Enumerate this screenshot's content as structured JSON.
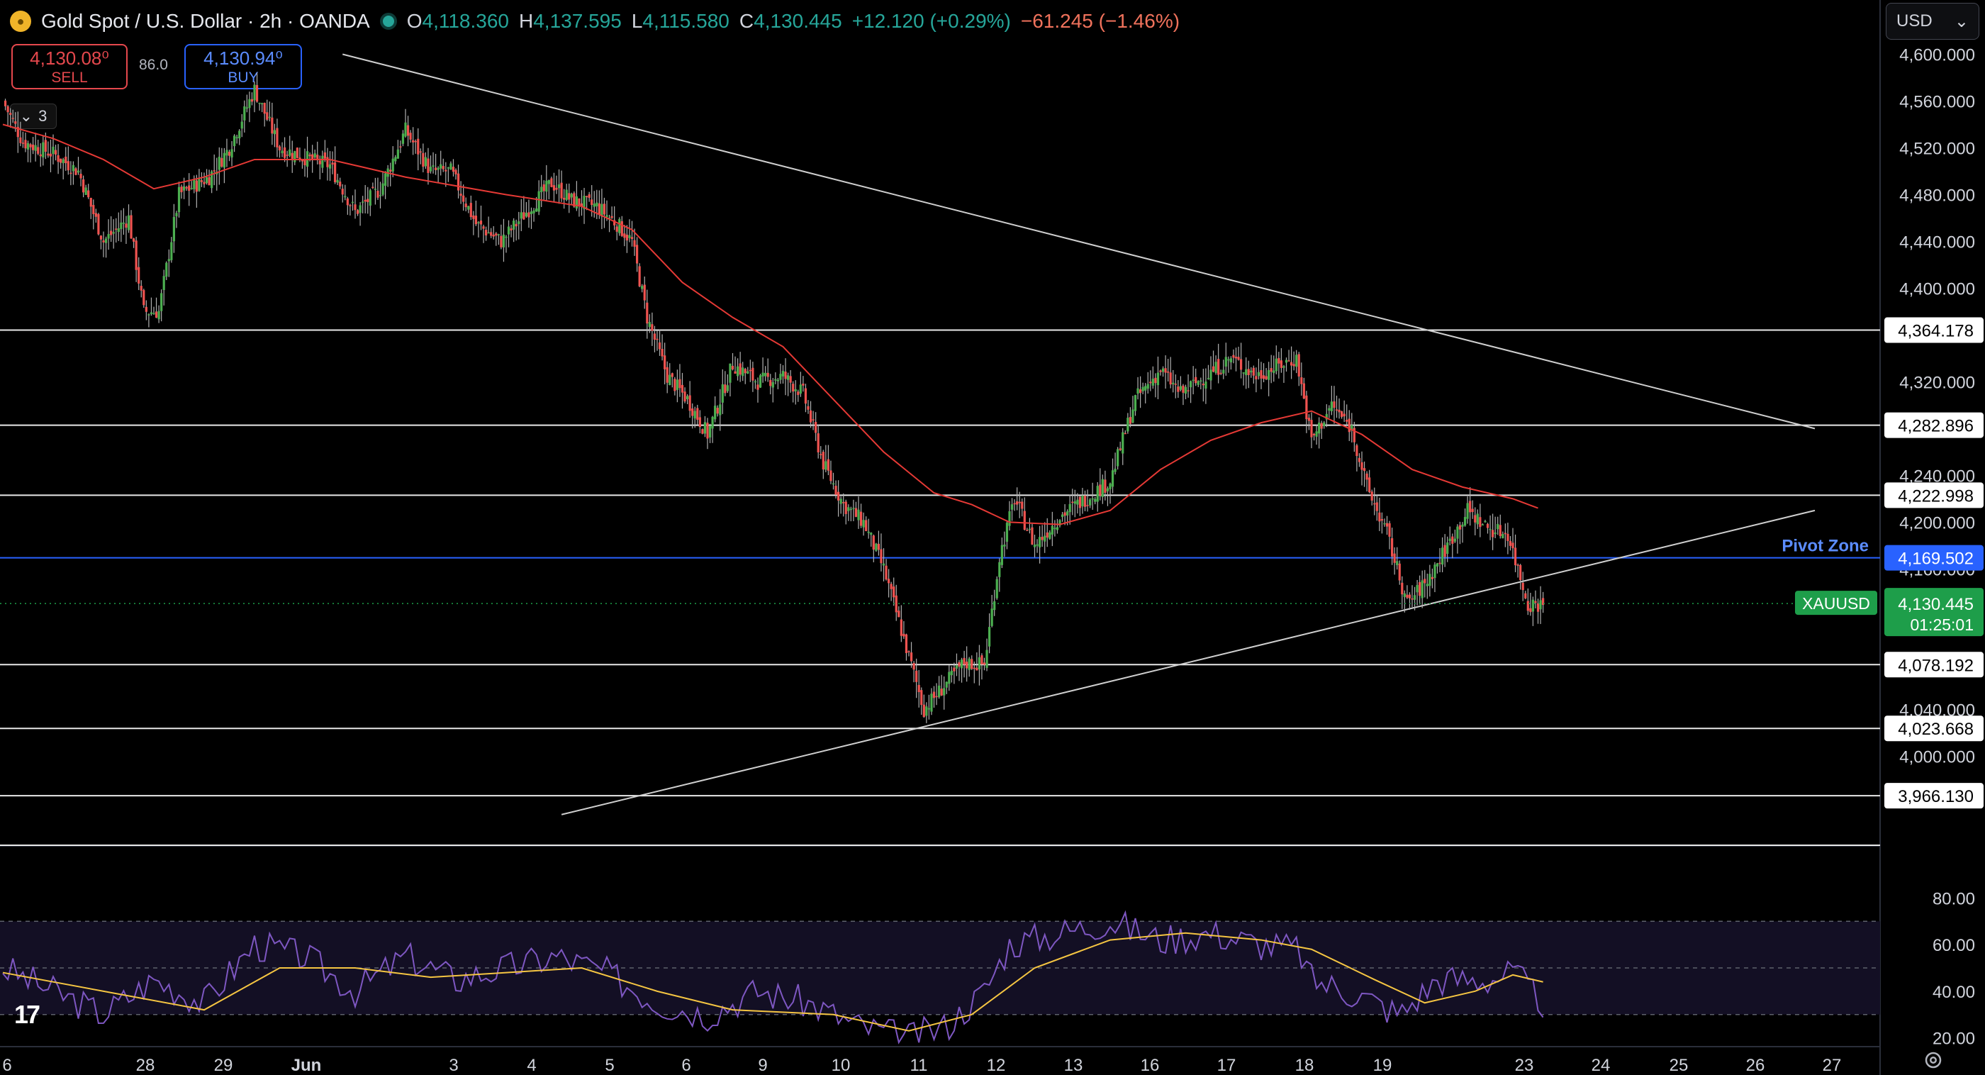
{
  "header": {
    "title": "Gold Spot / U.S. Dollar · 2h · OANDA",
    "open_label": "O",
    "open": "4,118.360",
    "high_label": "H",
    "high": "4,137.595",
    "low_label": "L",
    "low": "4,115.580",
    "close_label": "C",
    "close": "4,130.445",
    "change": "+12.120 (+0.29%)",
    "week_change": "−61.245 (−1.46%)"
  },
  "trade": {
    "sell_price": "4,130.08⁰",
    "sell_label": "SELL",
    "buy_price": "4,130.94⁰",
    "buy_label": "BUY",
    "spread": "86.0"
  },
  "indicators_toggle": {
    "count": "3"
  },
  "currency": {
    "selected": "USD"
  },
  "colors": {
    "up": "#4caf50",
    "down": "#ef5350",
    "ma": "#e53935",
    "pivot": "#2962ff",
    "rsi": "#7e57c2",
    "rsi_ma": "#f5c542",
    "current_price": "#1e9e4a"
  },
  "price_axis": {
    "ticks": [
      "4,600.000",
      "4,560.000",
      "4,520.000",
      "4,480.000",
      "4,440.000",
      "4,400.000",
      "4,320.000",
      "4,240.000",
      "4,200.000",
      "4,160.000",
      "4,040.000",
      "4,000.000"
    ]
  },
  "levels": [
    {
      "value": 4364.178,
      "label": "4,364.178"
    },
    {
      "value": 4282.896,
      "label": "4,282.896"
    },
    {
      "value": 4222.998,
      "label": "4,222.998"
    },
    {
      "value": 4169.502,
      "label": "4,169.502",
      "zone": "Pivot Zone"
    },
    {
      "value": 4078.192,
      "label": "4,078.192"
    },
    {
      "value": 4023.668,
      "label": "4,023.668"
    },
    {
      "value": 3966.13,
      "label": "3,966.130"
    }
  ],
  "current": {
    "symbol": "XAUUSD",
    "price": "4,130.445",
    "countdown": "01:25:01"
  },
  "time_axis": [
    "6",
    "28",
    "29",
    "Jun",
    "3",
    "4",
    "5",
    "6",
    "9",
    "10",
    "11",
    "12",
    "13",
    "16",
    "17",
    "18",
    "19",
    "23",
    "24",
    "25",
    "26",
    "27"
  ],
  "rsi_axis": [
    "80.00",
    "60.00",
    "40.00",
    "20.00"
  ],
  "chart_data": {
    "type": "candlestick",
    "symbol": "XAUUSD",
    "interval": "2h",
    "price_range": [
      3925,
      4610
    ],
    "close_path": [
      [
        0,
        4560
      ],
      [
        8,
        4525
      ],
      [
        20,
        4515
      ],
      [
        30,
        4500
      ],
      [
        40,
        4440
      ],
      [
        50,
        4460
      ],
      [
        56,
        4380
      ],
      [
        62,
        4380
      ],
      [
        70,
        4480
      ],
      [
        82,
        4495
      ],
      [
        90,
        4520
      ],
      [
        100,
        4570
      ],
      [
        110,
        4520
      ],
      [
        122,
        4510
      ],
      [
        130,
        4505
      ],
      [
        140,
        4465
      ],
      [
        150,
        4485
      ],
      [
        160,
        4535
      ],
      [
        170,
        4500
      ],
      [
        178,
        4500
      ],
      [
        188,
        4455
      ],
      [
        198,
        4440
      ],
      [
        208,
        4465
      ],
      [
        218,
        4490
      ],
      [
        226,
        4475
      ],
      [
        236,
        4470
      ],
      [
        244,
        4455
      ],
      [
        250,
        4440
      ],
      [
        256,
        4375
      ],
      [
        264,
        4325
      ],
      [
        272,
        4305
      ],
      [
        280,
        4275
      ],
      [
        290,
        4335
      ],
      [
        300,
        4320
      ],
      [
        310,
        4325
      ],
      [
        318,
        4310
      ],
      [
        326,
        4250
      ],
      [
        334,
        4215
      ],
      [
        342,
        4200
      ],
      [
        350,
        4160
      ],
      [
        358,
        4100
      ],
      [
        366,
        4040
      ],
      [
        374,
        4060
      ],
      [
        382,
        4080
      ],
      [
        390,
        4078
      ],
      [
        396,
        4170
      ],
      [
        402,
        4220
      ],
      [
        410,
        4180
      ],
      [
        420,
        4205
      ],
      [
        430,
        4220
      ],
      [
        440,
        4235
      ],
      [
        450,
        4305
      ],
      [
        460,
        4330
      ],
      [
        468,
        4310
      ],
      [
        478,
        4325
      ],
      [
        488,
        4340
      ],
      [
        498,
        4325
      ],
      [
        508,
        4335
      ],
      [
        514,
        4340
      ],
      [
        520,
        4270
      ],
      [
        528,
        4300
      ],
      [
        536,
        4280
      ],
      [
        542,
        4230
      ],
      [
        550,
        4190
      ],
      [
        558,
        4130
      ],
      [
        566,
        4150
      ],
      [
        574,
        4180
      ],
      [
        582,
        4210
      ],
      [
        590,
        4195
      ],
      [
        598,
        4190
      ],
      [
        606,
        4130
      ],
      [
        612,
        4130
      ]
    ],
    "ma_path": [
      [
        0,
        4540
      ],
      [
        20,
        4528
      ],
      [
        40,
        4510
      ],
      [
        60,
        4485
      ],
      [
        80,
        4495
      ],
      [
        100,
        4510
      ],
      [
        130,
        4510
      ],
      [
        160,
        4495
      ],
      [
        200,
        4480
      ],
      [
        230,
        4470
      ],
      [
        250,
        4450
      ],
      [
        270,
        4405
      ],
      [
        290,
        4375
      ],
      [
        310,
        4350
      ],
      [
        330,
        4305
      ],
      [
        350,
        4260
      ],
      [
        370,
        4225
      ],
      [
        385,
        4215
      ],
      [
        400,
        4200
      ],
      [
        420,
        4198
      ],
      [
        440,
        4210
      ],
      [
        460,
        4245
      ],
      [
        480,
        4270
      ],
      [
        500,
        4285
      ],
      [
        520,
        4295
      ],
      [
        540,
        4275
      ],
      [
        560,
        4245
      ],
      [
        580,
        4230
      ],
      [
        600,
        4220
      ],
      [
        610,
        4212
      ]
    ],
    "trendlines": [
      {
        "from": [
          135,
          4600
        ],
        "to": [
          720,
          4280
        ]
      },
      {
        "from": [
          222,
          3950
        ],
        "to": [
          720,
          4210
        ]
      }
    ],
    "rsi": {
      "range": [
        15,
        85
      ],
      "band": [
        30,
        70
      ],
      "rsi_path": [
        [
          0,
          50
        ],
        [
          20,
          40
        ],
        [
          40,
          30
        ],
        [
          60,
          45
        ],
        [
          80,
          35
        ],
        [
          100,
          60
        ],
        [
          120,
          55
        ],
        [
          140,
          40
        ],
        [
          160,
          55
        ],
        [
          180,
          45
        ],
        [
          200,
          50
        ],
        [
          220,
          55
        ],
        [
          240,
          48
        ],
        [
          260,
          35
        ],
        [
          280,
          30
        ],
        [
          300,
          40
        ],
        [
          320,
          35
        ],
        [
          340,
          25
        ],
        [
          360,
          20
        ],
        [
          375,
          25
        ],
        [
          390,
          40
        ],
        [
          400,
          60
        ],
        [
          420,
          65
        ],
        [
          440,
          70
        ],
        [
          460,
          62
        ],
        [
          480,
          65
        ],
        [
          500,
          60
        ],
        [
          515,
          58
        ],
        [
          520,
          45
        ],
        [
          540,
          38
        ],
        [
          555,
          30
        ],
        [
          570,
          45
        ],
        [
          590,
          45
        ],
        [
          600,
          48
        ],
        [
          612,
          35
        ]
      ],
      "rsi_ma_path": [
        [
          0,
          48
        ],
        [
          40,
          40
        ],
        [
          80,
          32
        ],
        [
          110,
          50
        ],
        [
          140,
          50
        ],
        [
          170,
          46
        ],
        [
          200,
          48
        ],
        [
          230,
          50
        ],
        [
          260,
          40
        ],
        [
          290,
          32
        ],
        [
          330,
          30
        ],
        [
          360,
          23
        ],
        [
          385,
          30
        ],
        [
          410,
          50
        ],
        [
          440,
          62
        ],
        [
          470,
          65
        ],
        [
          500,
          62
        ],
        [
          520,
          58
        ],
        [
          545,
          45
        ],
        [
          565,
          35
        ],
        [
          585,
          40
        ],
        [
          600,
          47
        ],
        [
          612,
          44
        ]
      ]
    },
    "last_candle_index": 612,
    "grid": false
  }
}
